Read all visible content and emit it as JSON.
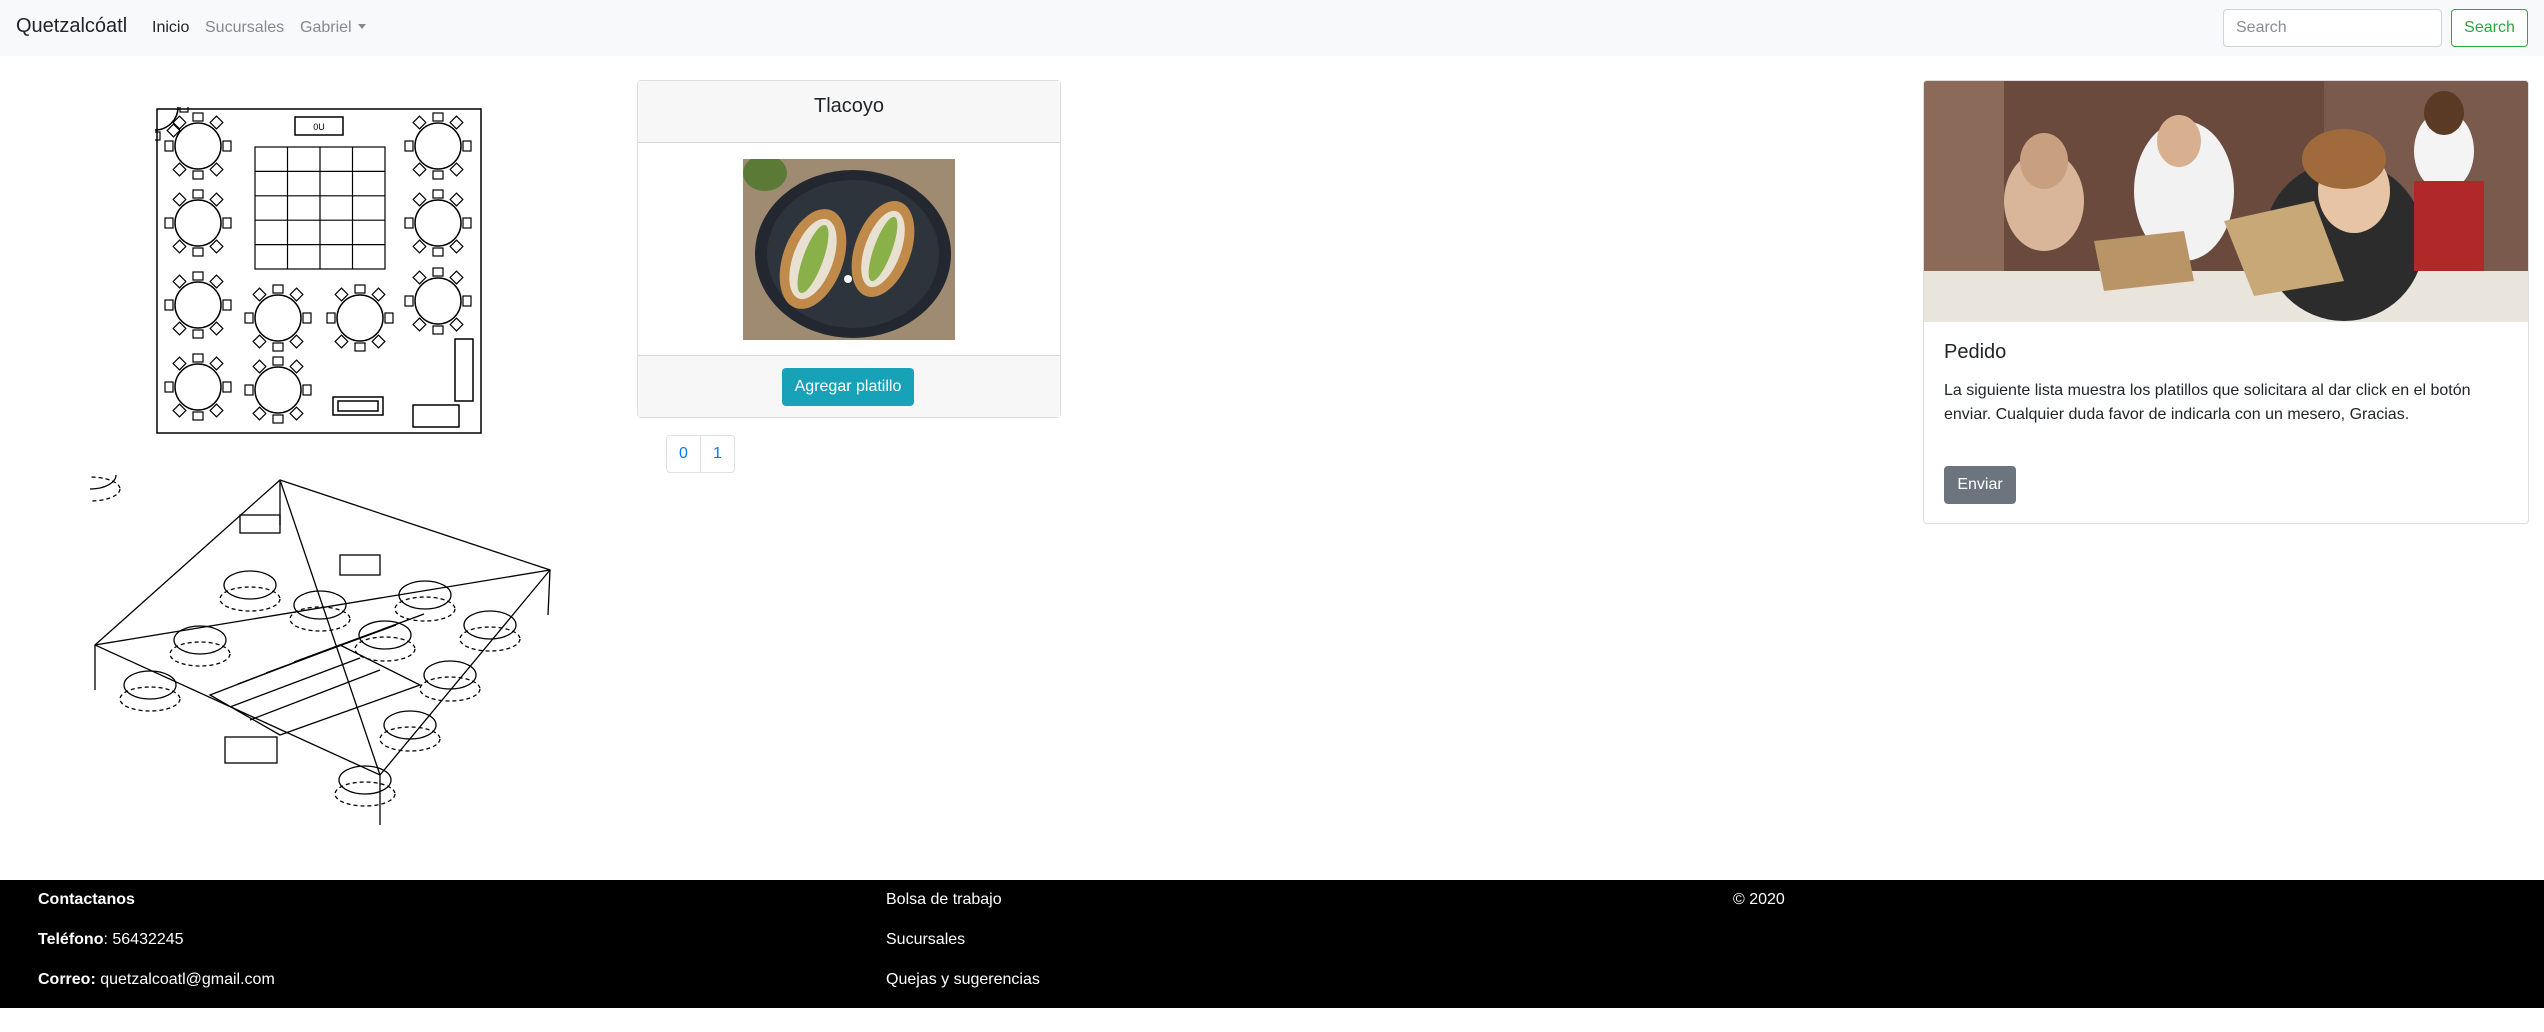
{
  "navbar": {
    "brand": "Quetzalcóatl",
    "links": [
      {
        "label": "Inicio",
        "active": true
      },
      {
        "label": "Sucursales",
        "active": false
      },
      {
        "label": "Gabriel",
        "dropdown": true
      }
    ],
    "search": {
      "placeholder": "Search",
      "value": "",
      "button_label": "Search"
    }
  },
  "layout_images": {
    "floor_plan": {
      "stage_label": "0U"
    }
  },
  "dish_card": {
    "title": "Tlacoyo",
    "button_label": "Agregar platillo"
  },
  "pagination": {
    "pages": [
      "0",
      "1"
    ]
  },
  "order_card": {
    "title": "Pedido",
    "text": "La siguiente lista muestra los platillos que solicitara al dar click en el botón enviar. Cualquier duda favor de indicarla con un mesero, Gracias.",
    "button_label": "Enviar"
  },
  "footer": {
    "contact_heading": "Contactanos",
    "phone_label": "Teléfono",
    "phone": ": 56432245",
    "email_label": "Correo:",
    "email": " quetzalcoatl@gmail.com",
    "links": [
      "Bolsa de trabajo",
      "Sucursales",
      "Quejas y sugerencias"
    ],
    "copyright": "© 2020"
  },
  "colors": {
    "navbar_bg": "#f8f9fa",
    "success": "#28a745",
    "info": "#17a2b8",
    "secondary": "#6c757d",
    "link": "#007bff",
    "footer_bg": "#000000"
  }
}
